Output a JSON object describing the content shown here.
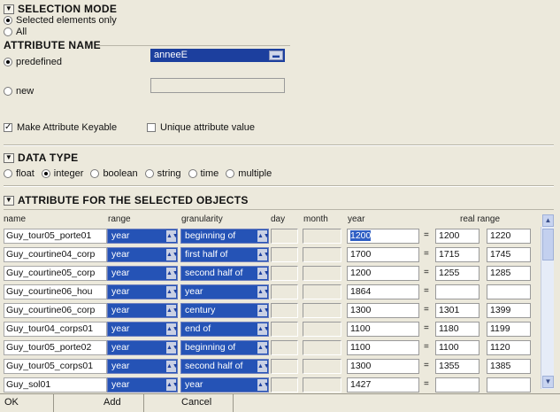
{
  "selection_mode": {
    "title": "SELECTION MODE",
    "options": [
      "Selected elements only",
      "All"
    ],
    "selected": 0
  },
  "attribute_name": {
    "title": "ATTRIBUTE NAME",
    "predefined_label": "predefined",
    "predefined_value": "anneeE",
    "new_label": "new",
    "new_value": "",
    "make_keyable_label": "Make Attribute Keyable",
    "make_keyable_checked": true,
    "unique_label": "Unique attribute value",
    "unique_checked": false
  },
  "data_type": {
    "title": "DATA TYPE",
    "options": [
      "float",
      "integer",
      "boolean",
      "string",
      "time",
      "multiple"
    ],
    "selected": 1
  },
  "objects": {
    "title": "ATTRIBUTE FOR THE SELECTED OBJECTS",
    "columns": [
      "name",
      "range",
      "granularity",
      "day",
      "month",
      "year",
      "real range"
    ],
    "rows": [
      {
        "name": "Guy_tour05_porte01",
        "range": "year",
        "granularity": "beginning of",
        "year": "1200",
        "real_start": "1200",
        "real_end": "1220",
        "highlight": true
      },
      {
        "name": "Guy_courtine04_corp",
        "range": "year",
        "granularity": "first half of",
        "year": "1700",
        "real_start": "1715",
        "real_end": "1745"
      },
      {
        "name": "Guy_courtine05_corp",
        "range": "year",
        "granularity": "second half of",
        "year": "1200",
        "real_start": "1255",
        "real_end": "1285"
      },
      {
        "name": "Guy_courtine06_hou",
        "range": "year",
        "granularity": "year",
        "year": "1864",
        "real_start": "",
        "real_end": ""
      },
      {
        "name": "Guy_courtine06_corp",
        "range": "year",
        "granularity": "century",
        "year": "1300",
        "real_start": "1301",
        "real_end": "1399"
      },
      {
        "name": "Guy_tour04_corps01",
        "range": "year",
        "granularity": "end of",
        "year": "1100",
        "real_start": "1180",
        "real_end": "1199"
      },
      {
        "name": "Guy_tour05_porte02",
        "range": "year",
        "granularity": "beginning of",
        "year": "1100",
        "real_start": "1100",
        "real_end": "1120"
      },
      {
        "name": "Guy_tour05_corps01",
        "range": "year",
        "granularity": "second half of",
        "year": "1300",
        "real_start": "1355",
        "real_end": "1385"
      },
      {
        "name": "Guy_sol01",
        "range": "year",
        "granularity": "year",
        "year": "1427",
        "real_start": "",
        "real_end": ""
      }
    ]
  },
  "buttons": {
    "ok": "OK",
    "add": "Add",
    "cancel": "Cancel"
  },
  "icons": {
    "collapse": "triangle-down-icon",
    "dropdown": "dropdown-arrow-icon",
    "scroll_up": "chevron-up-icon",
    "scroll_down": "chevron-down-icon"
  },
  "colors": {
    "panel": "#ece9dc",
    "selection": "#1c3f9e",
    "cell_select": "#2553b6"
  }
}
